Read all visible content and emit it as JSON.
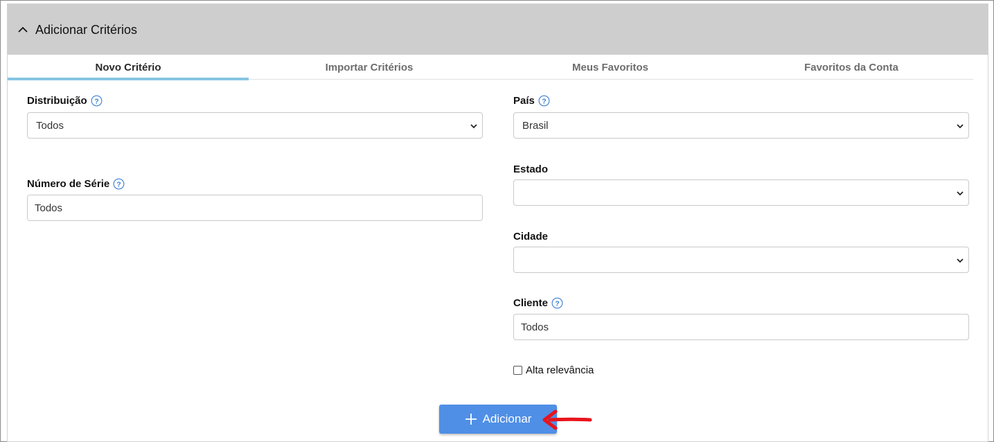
{
  "panel": {
    "title": "Adicionar Critérios",
    "collapse_icon": "chevron-up-icon"
  },
  "tabs": [
    {
      "label": "Novo Critério",
      "active": true
    },
    {
      "label": "Importar Critérios",
      "active": false
    },
    {
      "label": "Meus Favoritos",
      "active": false
    },
    {
      "label": "Favoritos da Conta",
      "active": false
    }
  ],
  "fields": {
    "distribuicao": {
      "label": "Distribuição",
      "value": "Todos",
      "has_help": true
    },
    "numero_serie": {
      "label": "Número de Série",
      "value": "Todos",
      "has_help": true
    },
    "pais": {
      "label": "País",
      "value": "Brasil",
      "has_help": true
    },
    "estado": {
      "label": "Estado",
      "value": ""
    },
    "cidade": {
      "label": "Cidade",
      "value": ""
    },
    "cliente": {
      "label": "Cliente",
      "value": "Todos",
      "has_help": true
    },
    "alta_relevancia": {
      "label": "Alta relevância",
      "checked": false
    }
  },
  "add_button": {
    "label": "Adicionar",
    "icon": "plus-icon"
  },
  "colors": {
    "header_bg": "#cecece",
    "tab_underline": "#86c5e3",
    "button_bg": "#4f8fe6",
    "help_icon": "#3a7fd5",
    "annotation_arrow": "#e8141c"
  }
}
